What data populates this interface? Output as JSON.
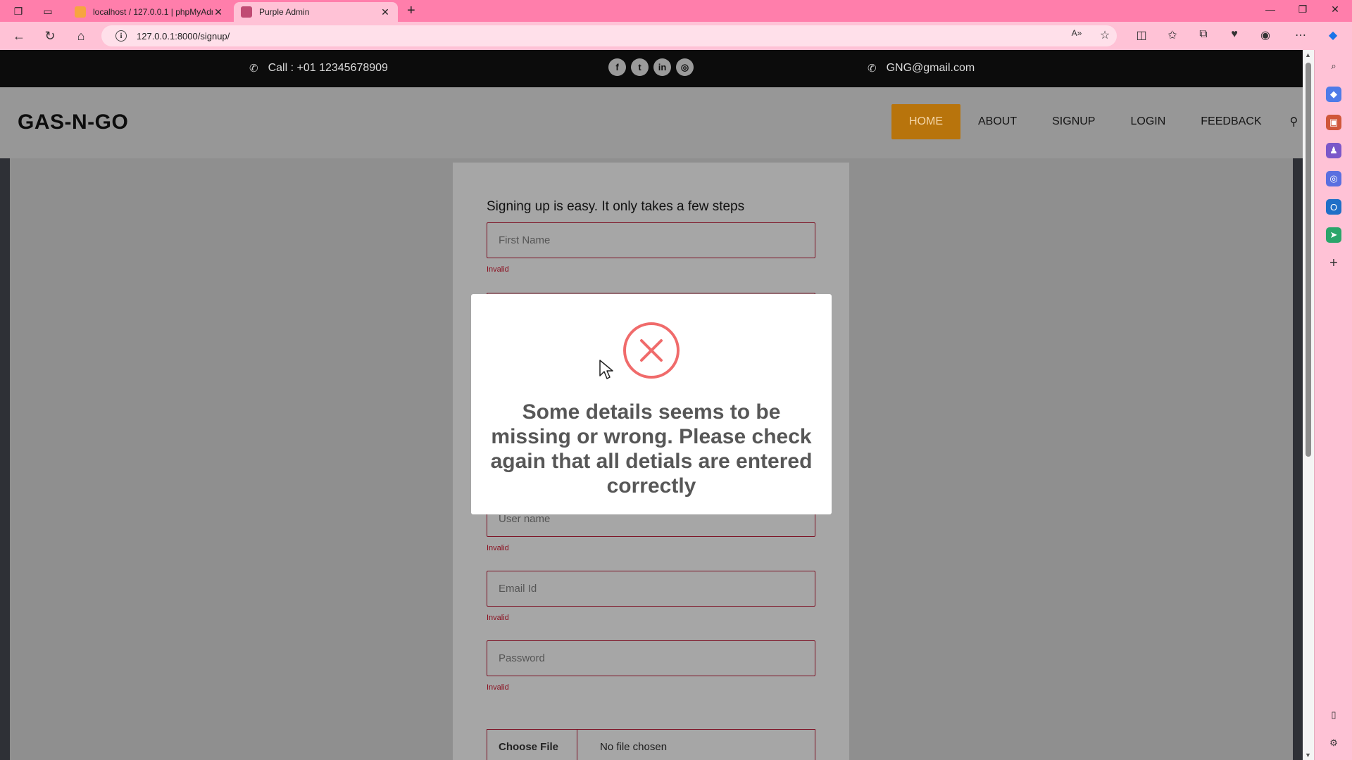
{
  "browser": {
    "tabs": [
      {
        "title": "localhost / 127.0.0.1 | phpMyAdm",
        "active": false
      },
      {
        "title": "Purple Admin",
        "active": true
      }
    ],
    "url": "127.0.0.1:8000/signup/"
  },
  "topbar": {
    "phone": "Call : +01 12345678909",
    "email": "GNG@gmail.com",
    "socials": [
      "facebook-icon",
      "twitter-icon",
      "linkedin-icon",
      "instagram-icon"
    ]
  },
  "header": {
    "logo": "GAS-N-GO",
    "menu": [
      "HOME",
      "ABOUT",
      "SIGNUP",
      "LOGIN",
      "FEEDBACK"
    ],
    "active_menu": "HOME"
  },
  "form": {
    "title": "Signing up is easy. It only takes a few steps",
    "first_name_placeholder": "First Name",
    "username_placeholder": "User name",
    "email_placeholder": "Email Id",
    "password_placeholder": "Password",
    "invalid_text": "Invalid",
    "choose_file": "Choose File",
    "no_file": "No file chosen"
  },
  "modal": {
    "icon": "error-x-icon",
    "message": "Some details seems to be missing or wrong. Please check again that all detials are entered correctly"
  },
  "colors": {
    "tab_bar": "#ff7eab",
    "address_bar": "#ffc2d6",
    "active_nav": "#b8740c",
    "field_border": "#7d1225",
    "error_icon": "#f06b6b"
  }
}
